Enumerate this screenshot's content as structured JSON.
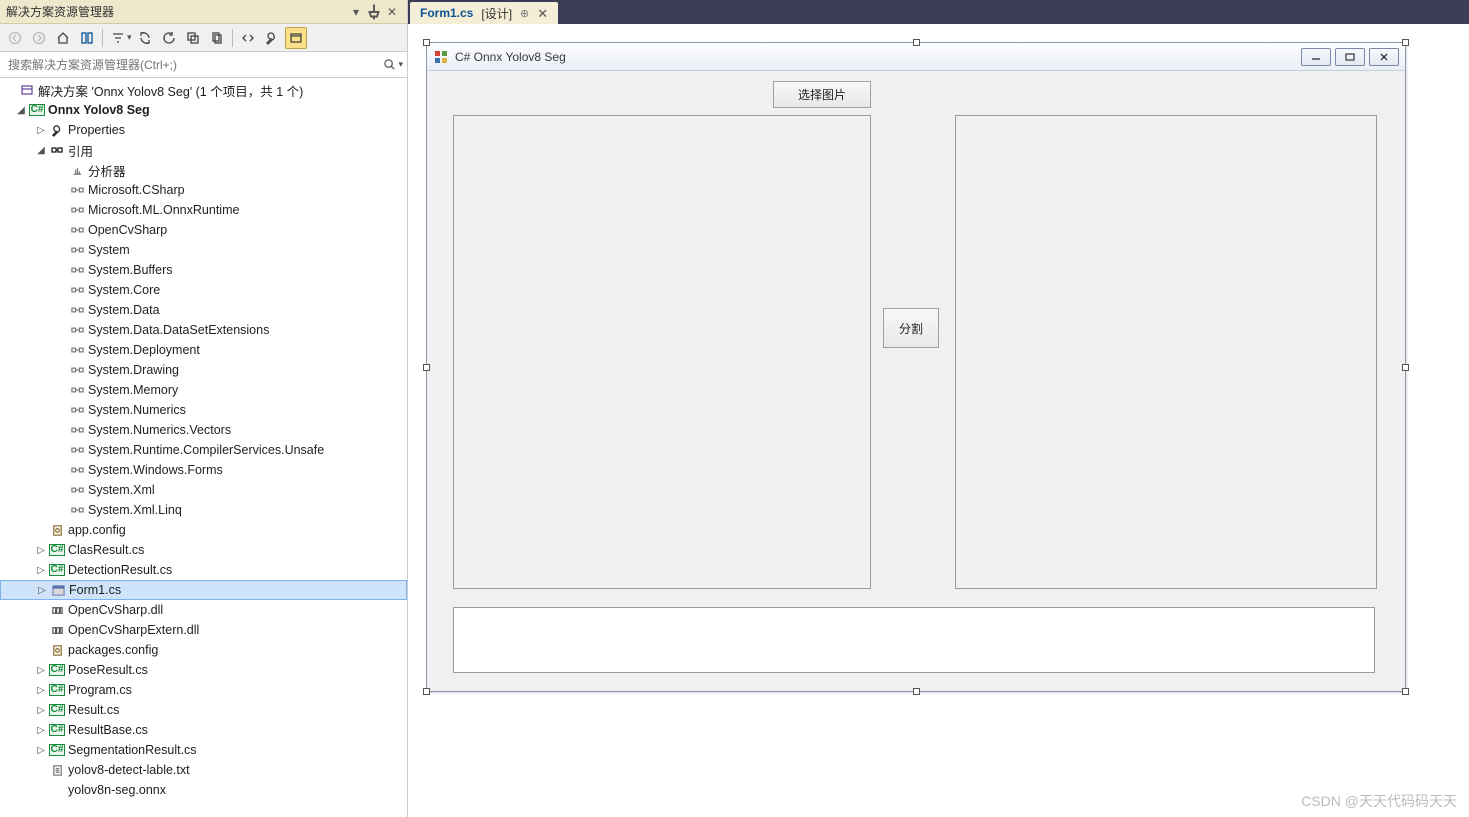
{
  "panel": {
    "title": "解决方案资源管理器",
    "search_placeholder": "搜索解决方案资源管理器(Ctrl+;)"
  },
  "tree": {
    "solution": "解决方案 'Onnx Yolov8 Seg' (1 个项目，共 1 个)",
    "project": "Onnx Yolov8 Seg",
    "properties": "Properties",
    "references": "引用",
    "analyzer": "分析器",
    "refs": [
      "Microsoft.CSharp",
      "Microsoft.ML.OnnxRuntime",
      "OpenCvSharp",
      "System",
      "System.Buffers",
      "System.Core",
      "System.Data",
      "System.Data.DataSetExtensions",
      "System.Deployment",
      "System.Drawing",
      "System.Memory",
      "System.Numerics",
      "System.Numerics.Vectors",
      "System.Runtime.CompilerServices.Unsafe",
      "System.Windows.Forms",
      "System.Xml",
      "System.Xml.Linq"
    ],
    "files": {
      "app_config": "app.config",
      "clasresult": "ClasResult.cs",
      "detectionresult": "DetectionResult.cs",
      "form1": "Form1.cs",
      "opencvsharp_dll": "OpenCvSharp.dll",
      "opencvsharpextern_dll": "OpenCvSharpExtern.dll",
      "packages_config": "packages.config",
      "poseresult": "PoseResult.cs",
      "program": "Program.cs",
      "result": "Result.cs",
      "resultbase": "ResultBase.cs",
      "segresult": "SegmentationResult.cs",
      "labels_txt": "yolov8-detect-lable.txt",
      "onnx_model": "yolov8n-seg.onnx"
    }
  },
  "tab": {
    "name": "Form1.cs",
    "suffix": "[设计]"
  },
  "form": {
    "title": "C# Onnx Yolov8 Seg",
    "btn_select": "选择图片",
    "btn_seg": "分割"
  },
  "watermark": "CSDN @天天代码码天天"
}
